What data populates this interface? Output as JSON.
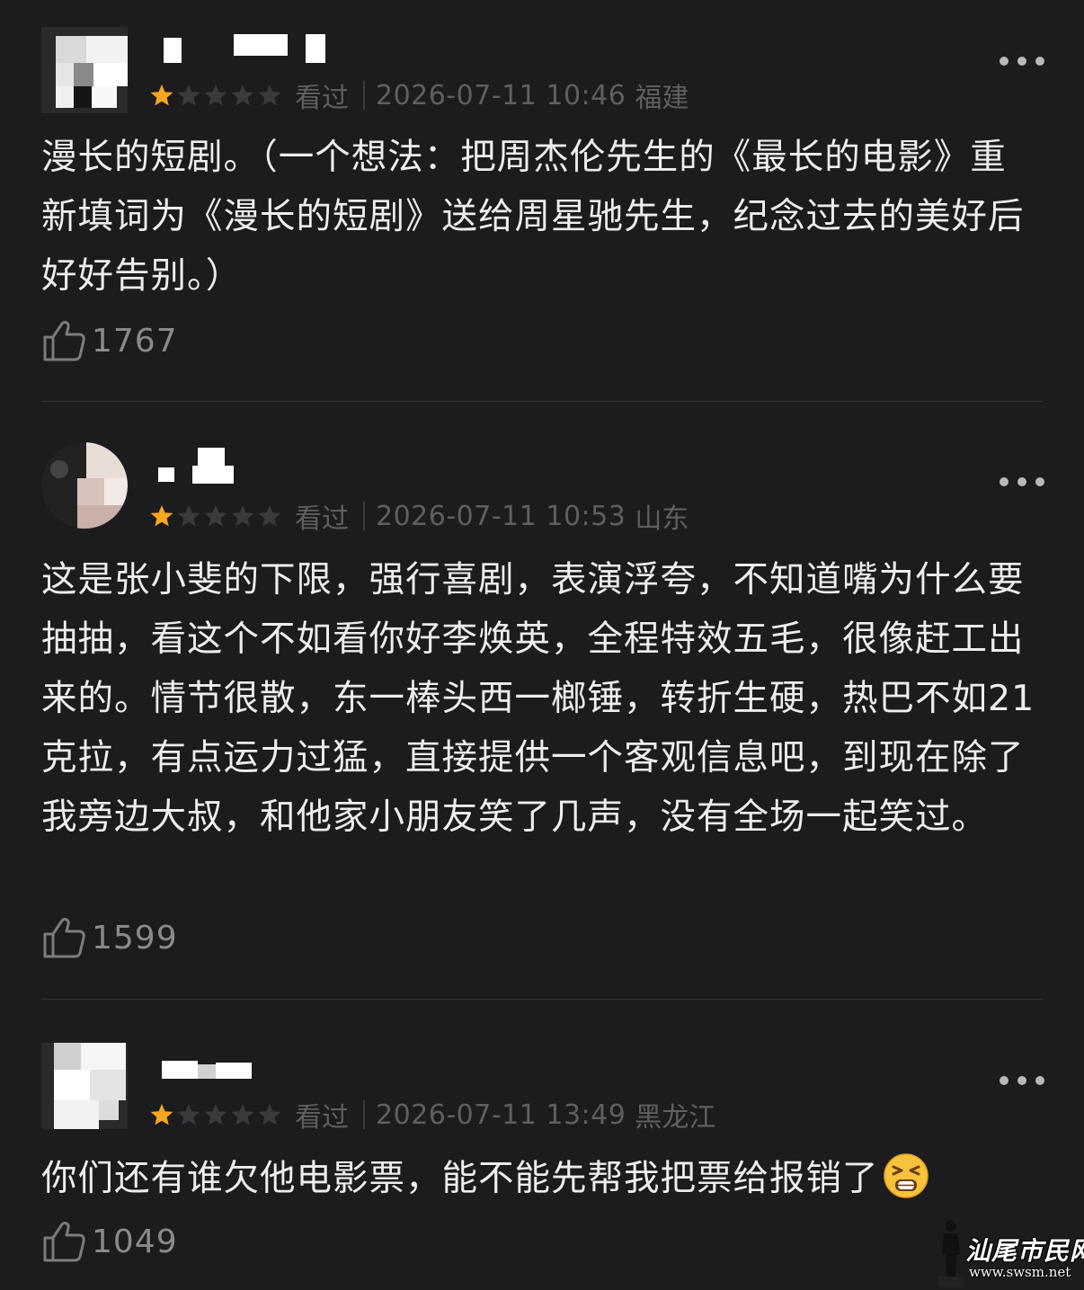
{
  "comments": [
    {
      "rating": 1,
      "watched_label": "看过",
      "date": "2026-07-11 10:46",
      "location": "福建",
      "text": "漫长的短剧。（一个想法：把周杰伦先生的《最长的电影》重新填词为《漫长的短剧》送给周星驰先生，纪念过去的美好后好好告别。）",
      "likes": "1767"
    },
    {
      "rating": 1,
      "watched_label": "看过",
      "date": "2026-07-11 10:53",
      "location": "山东",
      "text": "这是张小斐的下限，强行喜剧，表演浮夸，不知道嘴为什么要抽抽，看这个不如看你好李焕英，全程特效五毛，很像赶工出来的。情节很散，东一棒头西一榔锤，转折生硬，热巴不如21克拉，有点运力过猛，直接提供一个客观信息吧，到现在除了我旁边大叔，和他家小朋友笑了几声，没有全场一起笑过。",
      "likes": "1599"
    },
    {
      "rating": 1,
      "watched_label": "看过",
      "date": "2026-07-11 13:49",
      "location": "黑龙江",
      "text": "你们还有谁欠他电影票，能不能先帮我把票给报销了",
      "likes": "1049"
    }
  ],
  "icons": {
    "star_filled": "star-filled-icon",
    "star_empty": "star-empty-icon",
    "more": "more-dots-icon",
    "like": "thumbs-up-icon",
    "emoji": "tired-face-emoji"
  },
  "watermark": {
    "text": "汕尾市民网",
    "url": "www.swsm.net"
  },
  "colors": {
    "background": "#1c1c1e",
    "text": "#ededf0",
    "meta": "#5f5f63",
    "star_filled": "#f5a623",
    "star_empty": "#3a3a3c"
  }
}
